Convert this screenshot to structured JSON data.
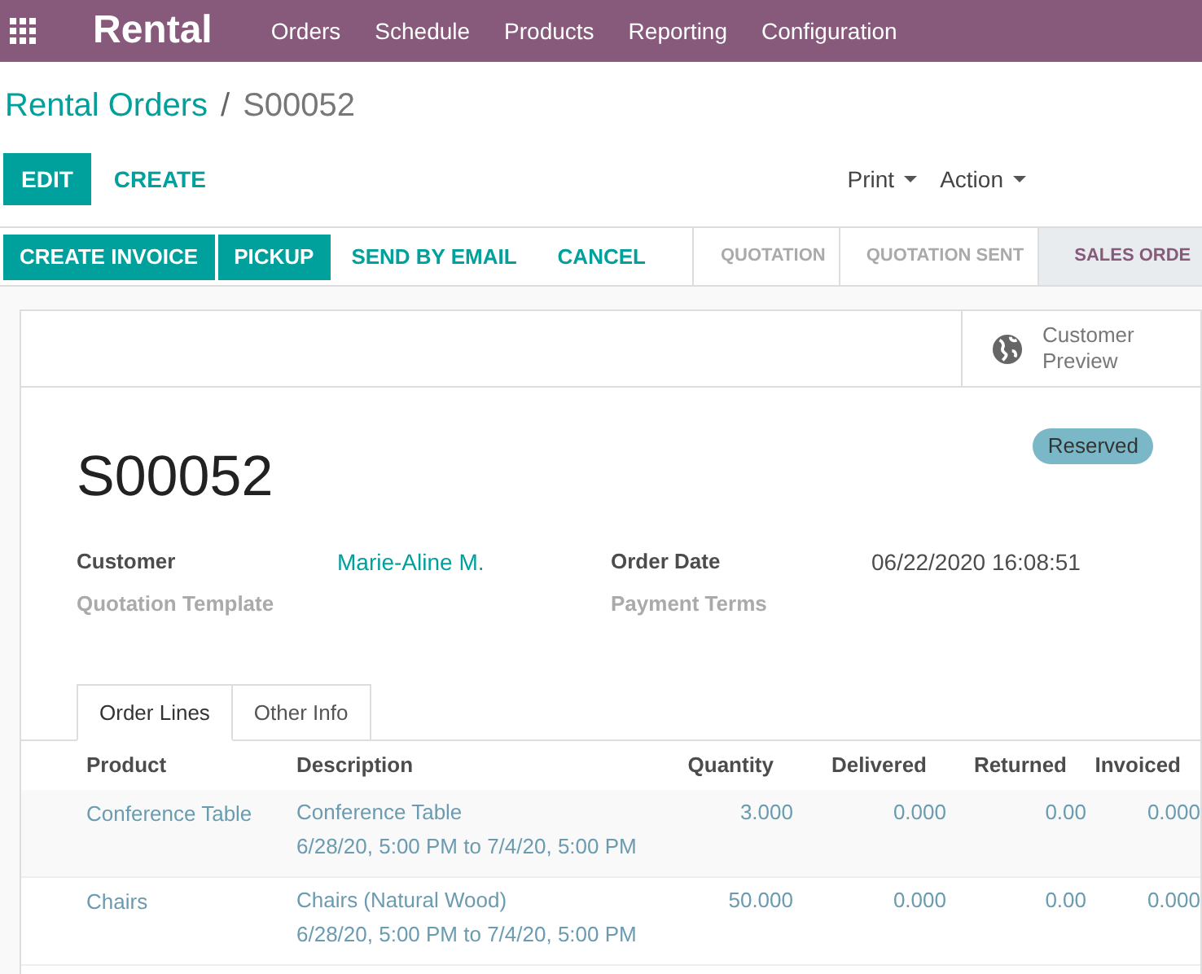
{
  "navbar": {
    "app_name": "Rental",
    "menu": [
      "Orders",
      "Schedule",
      "Products",
      "Reporting",
      "Configuration"
    ]
  },
  "breadcrumb": {
    "parent": "Rental Orders",
    "separator": "/",
    "current": "S00052"
  },
  "control_buttons": [
    {
      "label": "EDIT",
      "kind": "primary"
    },
    {
      "label": "CREATE",
      "kind": "link"
    }
  ],
  "dropdowns": [
    "Print",
    "Action"
  ],
  "header_buttons": [
    {
      "label": "CREATE INVOICE",
      "kind": "primary"
    },
    {
      "label": "PICKUP",
      "kind": "primary"
    },
    {
      "label": "SEND BY EMAIL",
      "kind": "link"
    },
    {
      "label": "CANCEL",
      "kind": "link"
    }
  ],
  "stages": [
    {
      "label": "QUOTATION",
      "selected": false
    },
    {
      "label": "QUOTATION SENT",
      "selected": false
    },
    {
      "label": "SALES ORDE",
      "selected": true
    }
  ],
  "smart_button": {
    "label": "Customer Preview"
  },
  "record": {
    "name": "S00052",
    "badge": "Reserved",
    "fields_left": [
      {
        "label": "Customer",
        "value": "Marie-Aline M.",
        "required": true
      },
      {
        "label": "Quotation Template",
        "required": false
      }
    ],
    "fields_right": [
      {
        "label": "Order Date",
        "value": "06/22/2020 16:08:51",
        "required": true
      },
      {
        "label": "Payment Terms",
        "required": false
      }
    ]
  },
  "tabs": [
    {
      "label": "Order Lines",
      "selected": true
    },
    {
      "label": "Other Info",
      "selected": false
    }
  ],
  "table": {
    "columns": [
      "Product",
      "Description",
      "Quantity",
      "Delivered",
      "Returned",
      "Invoiced"
    ],
    "rows": [
      {
        "product": "Conference Table",
        "description": "Conference Table",
        "period": "6/28/20, 5:00 PM to 7/4/20, 5:00 PM",
        "quantity": "3.000",
        "delivered": "0.000",
        "returned": "0.00",
        "invoiced": "0.000"
      },
      {
        "product": "Chairs",
        "description": "Chairs (Natural Wood)",
        "period": "6/28/20, 5:00 PM to 7/4/20, 5:00 PM",
        "quantity": "50.000",
        "delivered": "0.000",
        "returned": "0.00",
        "invoiced": "0.000"
      }
    ]
  }
}
